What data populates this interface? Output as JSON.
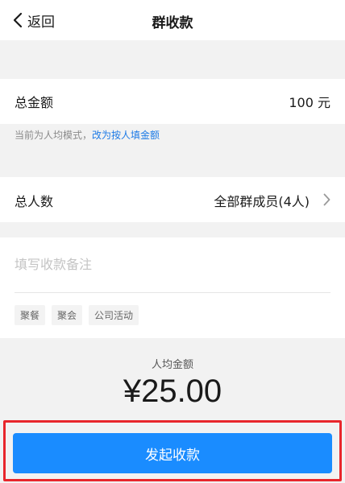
{
  "navbar": {
    "back_label": "返回",
    "title": "群收款",
    "icons": {
      "back": "chevron-left-icon"
    }
  },
  "amount": {
    "label": "总金额",
    "value": "100 元"
  },
  "hint": {
    "text": "当前为人均模式，",
    "link": "改为按人填金额"
  },
  "members": {
    "label": "总人数",
    "value": "全部群成员(4人)",
    "icon": "chevron-right-icon"
  },
  "note": {
    "placeholder": "填写收款备注",
    "value": "",
    "tags": [
      "聚餐",
      "聚会",
      "公司活动"
    ]
  },
  "per_person": {
    "label": "人均金额",
    "amount": "¥25.00"
  },
  "submit": {
    "label": "发起收款"
  },
  "colors": {
    "accent": "#1a8cff",
    "link": "#1e7be6",
    "highlight_border": "#e8262c",
    "background": "#f2f2f2"
  }
}
